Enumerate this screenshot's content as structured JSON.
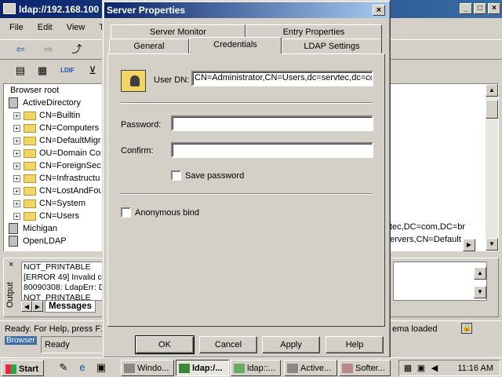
{
  "main_window": {
    "title": "ldap://192.168.100",
    "menu": [
      "File",
      "Edit",
      "View",
      "T"
    ],
    "tree": {
      "root_label": "Browser root",
      "server_label": "ActiveDirectory",
      "containers": [
        "CN=Builtin",
        "CN=Computers",
        "CN=DefaultMigr",
        "OU=Domain Con",
        "CN=ForeignSecu",
        "CN=Infrastructu",
        "CN=LostAndFou",
        "CN=System",
        "CN=Users"
      ],
      "servers": [
        "Michigan",
        "OpenLDAP"
      ]
    },
    "right_pane_lines": [
      "tec,DC=com,DC=br",
      "ervers,CN=Default"
    ],
    "output": {
      "vertical_label": "Output",
      "close_glyph": "×",
      "lines": [
        "NOT_PRINTABLE",
        "[ERROR 49] Invalid c",
        "80090308: LdapErr: D",
        "NOT_PRINTABLE"
      ],
      "tab_label": "Messages"
    },
    "statusbar_text": "Ready. For Help, press F1",
    "statusbar_right": "ema loaded",
    "browser_label": "Browser",
    "ready_text": "Ready"
  },
  "dialog": {
    "title": "Server Properties",
    "close_glyph": "×",
    "tabs_back": [
      "Server Monitor",
      "Entry Properties"
    ],
    "tabs_front": [
      "General",
      "Credentials",
      "LDAP Settings"
    ],
    "active_tab": "Credentials",
    "user_dn_label": "User DN:",
    "user_dn_value": "CN=Administrator,CN=Users,dc=servtec,dc=com",
    "password_label": "Password:",
    "password_value": "",
    "confirm_label": "Confirm:",
    "confirm_value": "",
    "save_password_label": "Save password",
    "save_password_checked": false,
    "anonymous_label": "Anonymous bind",
    "anonymous_checked": false,
    "buttons": {
      "ok": "OK",
      "cancel": "Cancel",
      "apply": "Apply",
      "help": "Help"
    }
  },
  "taskbar": {
    "start_label": "Start",
    "tasks": [
      "Windo...",
      "ldap:/...",
      "ldap::...",
      "Active...",
      "Softer..."
    ],
    "active_task": "ldap:/...",
    "clock": "11:16 AM"
  }
}
